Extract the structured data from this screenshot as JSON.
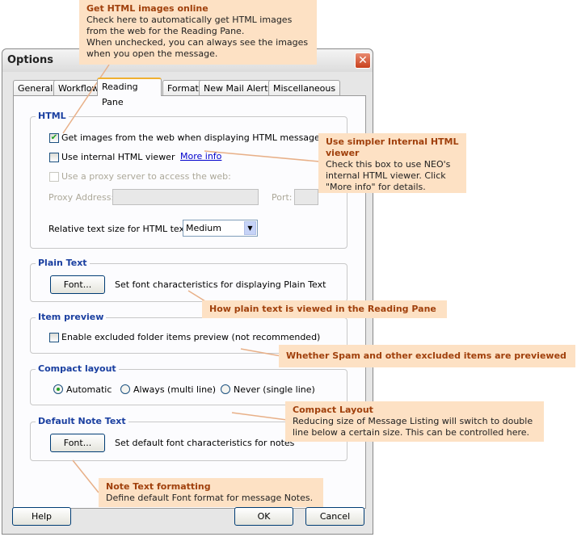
{
  "window": {
    "title": "Options"
  },
  "tabs": [
    {
      "label": "General"
    },
    {
      "label": "Workflow"
    },
    {
      "label": "Reading Pane",
      "active": true
    },
    {
      "label": "Format"
    },
    {
      "label": "New Mail Alerts"
    },
    {
      "label": "Miscellaneous"
    }
  ],
  "html": {
    "label": "HTML",
    "get_images": {
      "label": "Get images from the web when displaying HTML messages",
      "checked": true
    },
    "internal_viewer": {
      "label": "Use internal HTML viewer",
      "checked": false
    },
    "more_info": "More info",
    "proxy": {
      "label": "Use a proxy server to access the web:",
      "checked": false,
      "enabled": false
    },
    "proxy_address_label": "Proxy Address:",
    "proxy_address": "",
    "port_label": "Port:",
    "port": "",
    "text_size_label": "Relative text size for HTML text:",
    "text_size": "Medium"
  },
  "plain_text": {
    "label": "Plain Text",
    "font_button": "Font...",
    "desc": "Set font characteristics for displaying Plain Text"
  },
  "item_preview": {
    "label": "Item preview",
    "checkbox": {
      "label": "Enable excluded folder items preview (not recommended)",
      "checked": false
    }
  },
  "compact": {
    "label": "Compact layout",
    "options": [
      {
        "label": "Automatic",
        "selected": true
      },
      {
        "label": "Always (multi line)",
        "selected": false
      },
      {
        "label": "Never (single line)",
        "selected": false
      }
    ]
  },
  "note": {
    "label": "Default Note Text",
    "font_button": "Font...",
    "desc": "Set default font characteristics for notes"
  },
  "buttons": {
    "help": "Help",
    "ok": "OK",
    "cancel": "Cancel"
  },
  "callouts": [
    {
      "title": "Get HTML images online",
      "body": [
        "Check here to automatically get HTML images from the web for the Reading Pane.",
        "When unchecked, you can always see the images when you open the message."
      ]
    },
    {
      "title": "Use simpler Internal HTML viewer",
      "body": [
        "Check this box to use NEO's internal HTML viewer. Click \"More info\" for details."
      ]
    },
    {
      "title": "How plain text is viewed in the Reading Pane",
      "body": []
    },
    {
      "title": "Whether Spam and other excluded items are previewed",
      "body": []
    },
    {
      "title": "Compact Layout",
      "body": [
        "Reducing size of Message Listing will switch to double line below a certain size. This can be controlled here."
      ]
    },
    {
      "title": "Note Text formatting",
      "body": [
        "Define default Font format for message Notes."
      ]
    }
  ],
  "colors": {
    "callout_bg": "#fde1c4",
    "callout_title": "#a0400c",
    "group_label": "#1a3fa0",
    "leader_line": "#e8b088"
  }
}
